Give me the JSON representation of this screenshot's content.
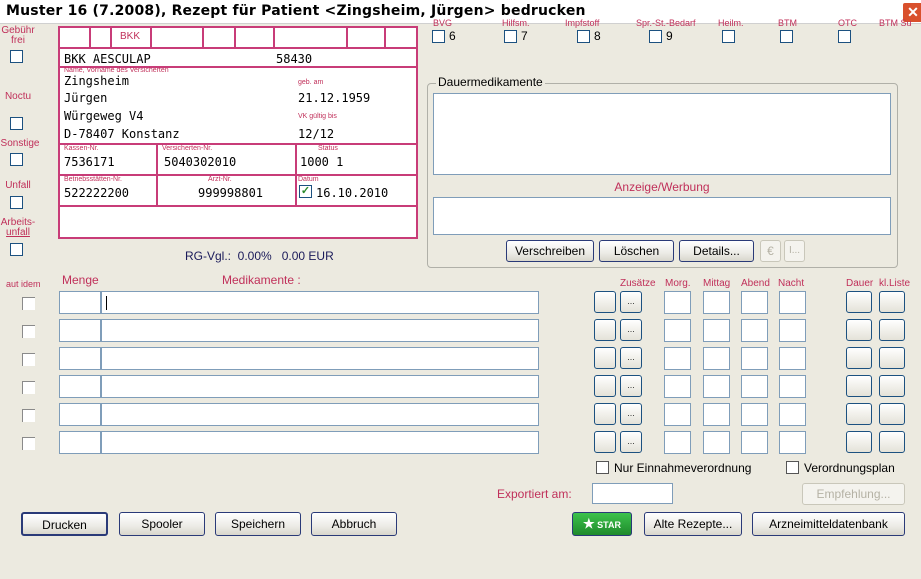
{
  "window": {
    "title": "Muster 16 (7.2008), Rezept für Patient <Zingsheim, Jürgen> bedrucken",
    "close_glyph": "✕"
  },
  "left_flags": [
    {
      "label_lines": [
        "Gebühr",
        "frei"
      ]
    },
    {
      "label_lines": [
        "Noctu"
      ]
    },
    {
      "label_lines": [
        "Sonstige"
      ]
    },
    {
      "label_lines": [
        "Unfall"
      ]
    },
    {
      "label_lines": [
        "Arbeits-",
        "unfall"
      ]
    }
  ],
  "form": {
    "top_cell": "BKK",
    "kasse_name": "BKK AESCULAP",
    "kasse_nr_top": "58430",
    "name_label": "Name, Vorname des Versicherten",
    "last_name": "Zingsheim",
    "first_name": "Jürgen",
    "street": "Würgeweg V4",
    "city": "D-78407 Konstanz",
    "geb_label": "geb. am",
    "birth_date": "21.12.1959",
    "vk_label": "VK gültig bis",
    "vk_valid": "12/12",
    "kassen_nr_label": "Kassen-Nr.",
    "kassen_nr": "7536171",
    "versicherten_nr_label": "Versicherten-Nr.",
    "versicherten_nr": "5040302010",
    "status_label": "Status",
    "status": "1000 1",
    "betrieb_label": "Betriebsstätten-Nr.",
    "betrieb_nr": "522222200",
    "arzt_label": "Arzt-Nr.",
    "arzt_nr": "999998801",
    "datum_label": "Datum",
    "datum": "16.10.2010"
  },
  "rg_vgl": "RG-Vgl.:  0.00%   0.00 EUR",
  "top_flags": [
    {
      "label": "BVG",
      "num": "6"
    },
    {
      "label": "Hilfsm.",
      "num": "7"
    },
    {
      "label": "Impfstoff",
      "num": "8"
    },
    {
      "label": "Spr.-St.-Bedarf",
      "num": "9"
    },
    {
      "label": "Heilm.",
      "num": ""
    },
    {
      "label": "BTM",
      "num": ""
    },
    {
      "label": "OTC",
      "num": ""
    },
    {
      "label": "BTM Su",
      "num": ""
    }
  ],
  "dauer": {
    "group_label": "Dauermedikamente",
    "ad_label": "Anzeige/Werbung"
  },
  "dauer_buttons": {
    "verschreiben": "Verschreiben",
    "loeschen": "Löschen",
    "details": "Details...",
    "euro": "€",
    "info": "I..."
  },
  "meds": {
    "aut_idem": "aut idem",
    "menge": "Menge",
    "medikamente": "Medikamente :",
    "zusaetze": "Zusätze",
    "morg": "Morg.",
    "mittag": "Mittag",
    "abend": "Abend",
    "nacht": "Nacht",
    "dauer": "Dauer",
    "klliste": "kl.Liste",
    "ellipsis": "...",
    "rows": [
      0,
      1,
      2,
      3,
      4,
      5
    ]
  },
  "options": {
    "nur_einnahme": "Nur Einnahmeverordnung",
    "verordnungsplan": "Verordnungsplan",
    "exportiert": "Exportiert am:",
    "empfehlung": "Empfehlung..."
  },
  "bottom_buttons": {
    "drucken": "Drucken",
    "spooler": "Spooler",
    "speichern": "Speichern",
    "abbruch": "Abbruch",
    "star": "STAR",
    "alte": "Alte Rezepte...",
    "amdb": "Arzneimitteldatenbank"
  },
  "colors": {
    "accent_pink": "#c83c78",
    "label_red": "#c0305a",
    "close_red": "#d9502c",
    "star_green": "#2a9a3a"
  }
}
